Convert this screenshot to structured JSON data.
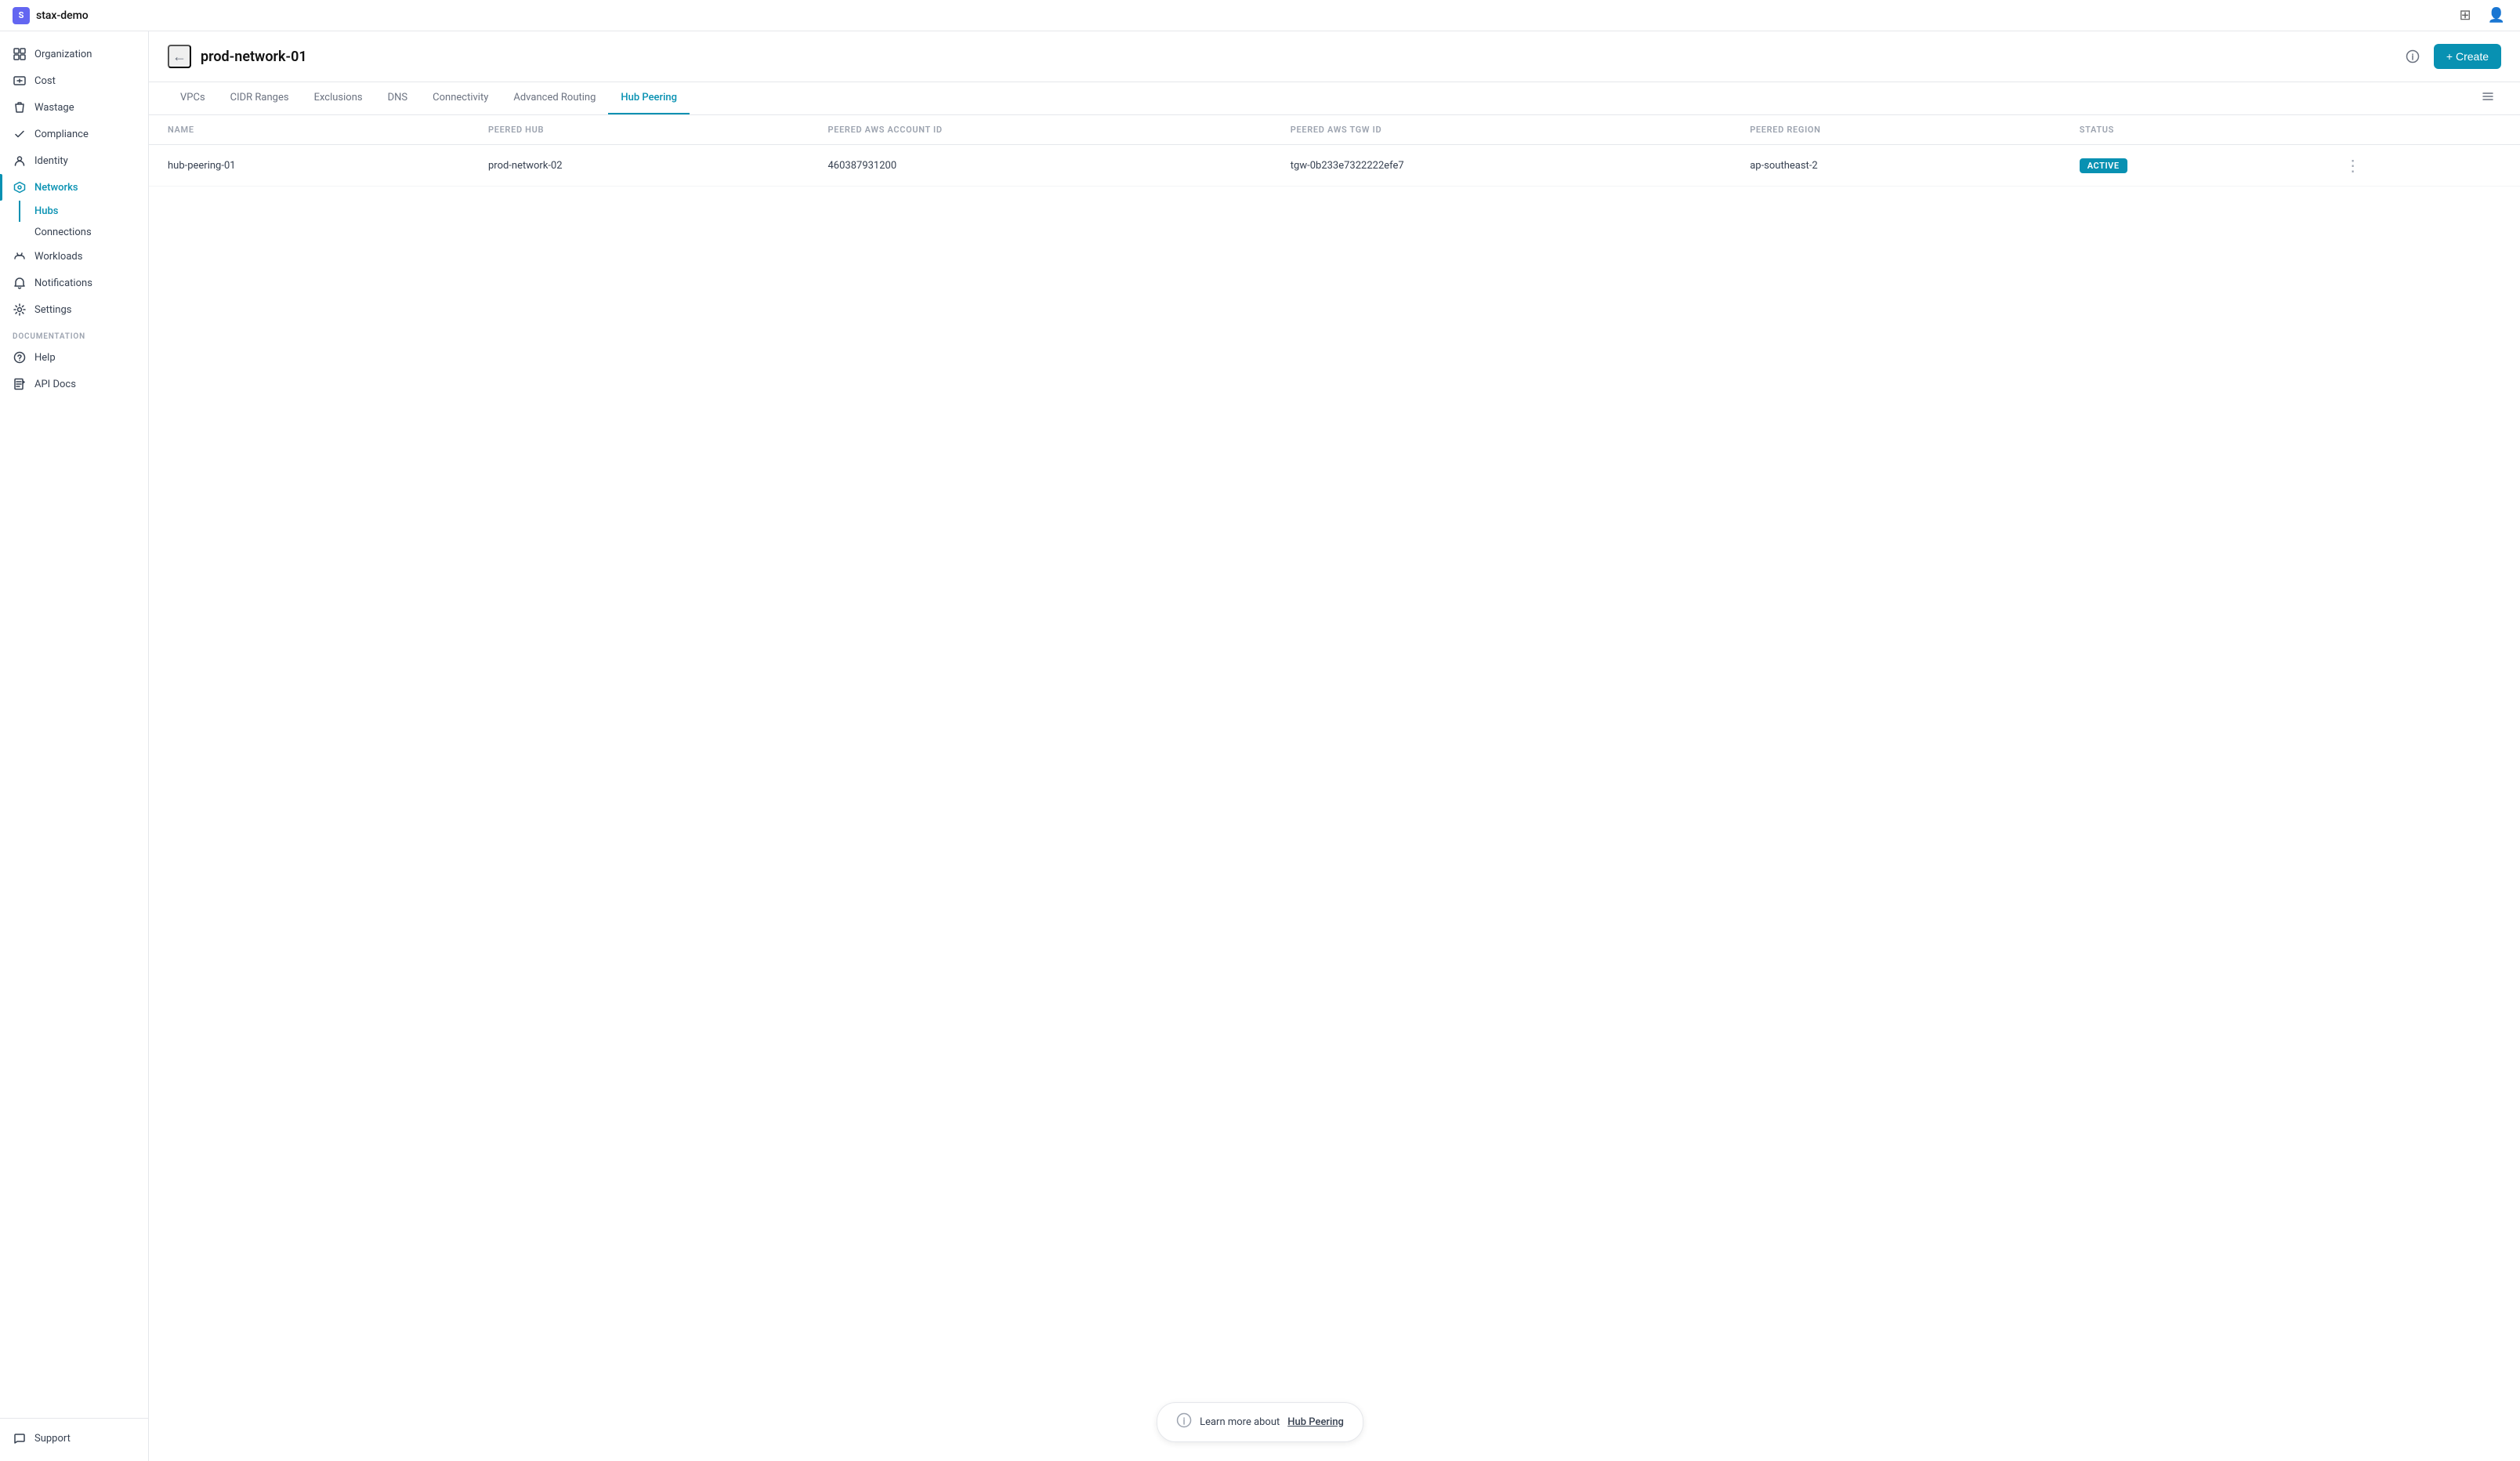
{
  "app": {
    "name": "stax-demo",
    "logo_label": "S"
  },
  "topbar": {
    "grid_icon": "⊞",
    "user_icon": "👤"
  },
  "sidebar": {
    "collapse_icon": "‹",
    "items": [
      {
        "id": "organization",
        "label": "Organization",
        "icon": "🏢",
        "active": false
      },
      {
        "id": "cost",
        "label": "Cost",
        "icon": "💳",
        "active": false
      },
      {
        "id": "wastage",
        "label": "Wastage",
        "icon": "🗑",
        "active": false
      },
      {
        "id": "compliance",
        "label": "Compliance",
        "icon": "✔",
        "active": false
      },
      {
        "id": "identity",
        "label": "Identity",
        "icon": "🔑",
        "active": false
      },
      {
        "id": "networks",
        "label": "Networks",
        "icon": "⬡",
        "active": true
      },
      {
        "id": "workloads",
        "label": "Workloads",
        "icon": "☁",
        "active": false
      },
      {
        "id": "notifications",
        "label": "Notifications",
        "icon": "🔔",
        "active": false
      },
      {
        "id": "settings",
        "label": "Settings",
        "icon": "⚙",
        "active": false
      }
    ],
    "sub_items": [
      {
        "id": "hubs",
        "label": "Hubs",
        "active": true
      },
      {
        "id": "connections",
        "label": "Connections",
        "active": false
      }
    ],
    "documentation_label": "DOCUMENTATION",
    "doc_items": [
      {
        "id": "help",
        "label": "Help",
        "icon": "?"
      },
      {
        "id": "api-docs",
        "label": "API Docs",
        "icon": "📄"
      }
    ],
    "bottom_items": [
      {
        "id": "support",
        "label": "Support",
        "icon": "💬"
      }
    ]
  },
  "page": {
    "back_icon": "←",
    "title": "prod-network-01",
    "info_icon": "ℹ",
    "create_label": "+ Create"
  },
  "tabs": [
    {
      "id": "vpcs",
      "label": "VPCs",
      "active": false
    },
    {
      "id": "cidr-ranges",
      "label": "CIDR Ranges",
      "active": false
    },
    {
      "id": "exclusions",
      "label": "Exclusions",
      "active": false
    },
    {
      "id": "dns",
      "label": "DNS",
      "active": false
    },
    {
      "id": "connectivity",
      "label": "Connectivity",
      "active": false
    },
    {
      "id": "advanced-routing",
      "label": "Advanced Routing",
      "active": false
    },
    {
      "id": "hub-peering",
      "label": "Hub Peering",
      "active": true
    }
  ],
  "column_toggle_icon": "≡",
  "table": {
    "columns": [
      {
        "id": "name",
        "label": "NAME"
      },
      {
        "id": "peered-hub",
        "label": "PEERED HUB"
      },
      {
        "id": "peered-aws-account-id",
        "label": "PEERED AWS ACCOUNT ID"
      },
      {
        "id": "peered-aws-tgw-id",
        "label": "PEERED AWS TGW ID"
      },
      {
        "id": "peered-region",
        "label": "PEERED REGION"
      },
      {
        "id": "status",
        "label": "STATUS"
      }
    ],
    "rows": [
      {
        "name": "hub-peering-01",
        "peered_hub": "prod-network-02",
        "peered_aws_account_id": "460387931200",
        "peered_aws_tgw_id": "tgw-0b233e7322222efe7",
        "peered_region": "ap-southeast-2",
        "status": "ACTIVE",
        "status_color": "active"
      }
    ]
  },
  "bottom_info": {
    "icon": "?",
    "text": "Learn more about",
    "link_text": "Hub Peering"
  }
}
